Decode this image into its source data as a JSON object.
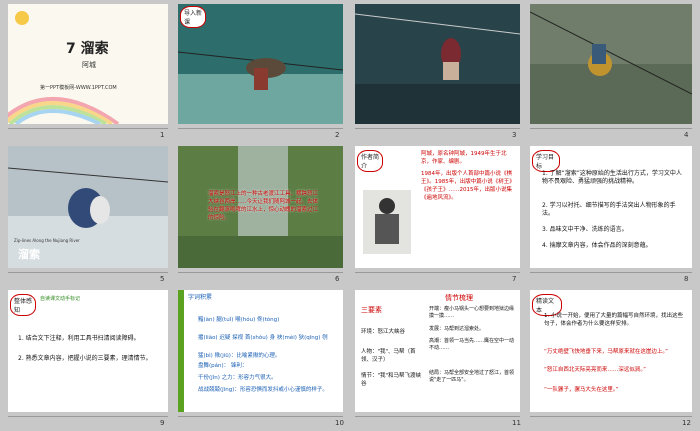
{
  "slides": [
    {
      "num": "1",
      "title": "7 溜索",
      "author": "阿城",
      "footer": "第一PPT模板网-WWW.1PPT.COM"
    },
    {
      "num": "2",
      "tag": "导入新课"
    },
    {
      "num": "3"
    },
    {
      "num": "4"
    },
    {
      "num": "5",
      "caption": "溜索",
      "small": "Zip-lines Along the Nujiang River"
    },
    {
      "num": "6",
      "text": "溜索是怒江上的一种古老渡江工具，横跨怒江大峡谷两岸……今天让我们随阿城一起，去体验在翻滚咆哮的江水上，惊心动魄的溜索过江的惊险。"
    },
    {
      "num": "7",
      "tag": "作者简介",
      "head": "阿城，原名钟阿城，1949年生于北京，作家、编剧。",
      "body": "1984年，出版个人首部中篇小说《棋王》。1985年，出版中篇小说《树王》《孩子王》……2015年，出版小说集《遍地风流》。"
    },
    {
      "num": "8",
      "tag": "学习目标",
      "items": [
        "1. 了解“溜索”这种原始的生活出行方式，学习文中人物不畏艰险、勇猛顽强的挑战精神。",
        "2. 学习以衬托、细节描写的手法突出人物形象的手法。",
        "3. 品味文中干净、洗练的语言。",
        "4. 揣摩文章内容，体会作品的深刻意蕴。"
      ]
    },
    {
      "num": "9",
      "tag": "整体感知",
      "sub": "自读课文动手标记",
      "items": [
        "1. 结合文下注释，利用工具书扫清阅读障碍。",
        "2. 熟悉文章内容，把握小说的三要素，理清情节。"
      ]
    },
    {
      "num": "10",
      "tag": "字词积累",
      "lines": [
        "黯(àn)  腿(tuǐ)  喉(hóu)  佟(tóng)",
        "撂(liào)  迟疑  探视  首(shǒu)  身 袂(mèi)  狄(qīng)  刎",
        "猛(bì)  揪(jiū)：比喻紧揪的心理。",
        "盘舞(pán)：  锋利：",
        "千份(jǐn) 之力：形容力气很大。",
        "战战兢兢(jīng)：形容恐惧而发抖或小心谨慎的样子。"
      ]
    },
    {
      "num": "11",
      "head": "三要素",
      "env": "环境：怒江大峡谷",
      "people": "人物：\"我\"、马帮（首领、汉子）",
      "plot": "情节：\"我\"和马帮飞渡峡谷"
    },
    {
      "num": "11b",
      "head": "情节梳理",
      "lines": [
        "开端：瘦小马锅头一心想要到地狱边缘摸一摸……",
        "发展：马帮到达溜索处。",
        "高潮：首领一马当先……鹰在空中一动不动……",
        "结局：马帮全部安全地过了怒江，首领说\"走了一匹马\"。"
      ]
    },
    {
      "num": "12",
      "tag": "精读文本",
      "lines": [
        "1. 小说一开始，便用了大量的篇幅写自然环境，找出这些句子，体会作者为什么要这样安排。",
        "“万丈绝壁飞快地垂下来，马帮原来就在这崖边上。”",
        "“怒江自西北天际亮亮而来……深远似涧。”",
        "“一队骡子，骡马大头在这里。”"
      ]
    }
  ]
}
